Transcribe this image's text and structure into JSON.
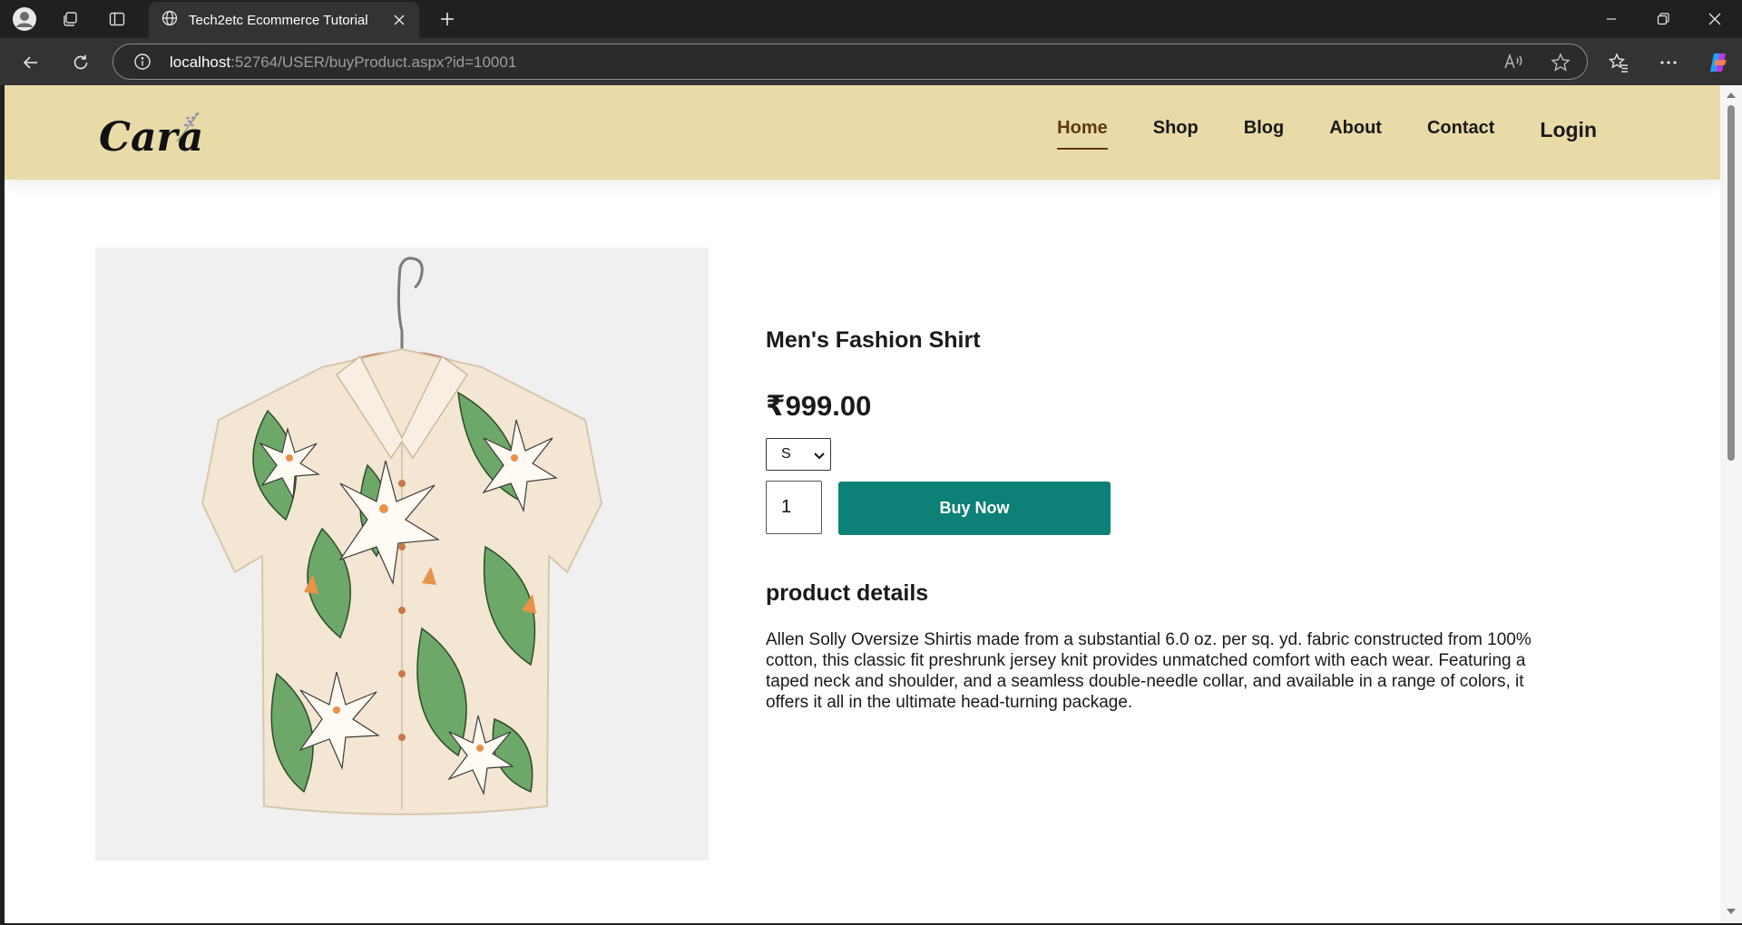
{
  "browser": {
    "tab_title": "Tech2etc Ecommerce Tutorial",
    "url_host": "localhost",
    "url_rest": ":52764/USER/buyProduct.aspx?id=10001"
  },
  "site": {
    "logo_text": "Cara",
    "nav": [
      {
        "label": "Home",
        "active": true
      },
      {
        "label": "Shop"
      },
      {
        "label": "Blog"
      },
      {
        "label": "About"
      },
      {
        "label": "Contact"
      },
      {
        "label": "Login"
      }
    ]
  },
  "product": {
    "title": "Men's Fashion Shirt",
    "price": "₹999.00",
    "size_selected": "S",
    "quantity": "1",
    "buy_label": "Buy Now",
    "details_heading": "product details",
    "details_text": "Allen Solly Oversize Shirtis made from a substantial 6.0 oz. per sq. yd. fabric constructed from 100% cotton, this classic fit preshrunk jersey knit provides unmatched comfort with each wear. Featuring a taped neck and shoulder, and a seamless double-needle collar, and available in a range of colors, it offers it all in the ultimate head-turning package."
  },
  "colors": {
    "header_bg": "#e9dba8",
    "accent": "#0d8077",
    "nav_active": "#5c3a0c"
  }
}
